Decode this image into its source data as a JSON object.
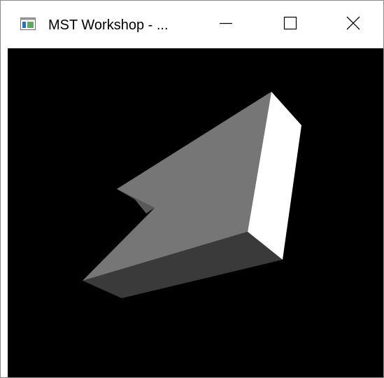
{
  "window": {
    "title": "MST Workshop - ...",
    "icons": {
      "app": "app-window-icon",
      "minimize": "minimize-icon",
      "maximize": "maximize-icon",
      "close": "close-icon"
    }
  },
  "viewport": {
    "background": "#000000",
    "content": "3d-rendered-prism",
    "face_colors": [
      "#767676",
      "#ffffff",
      "#3a3a3a",
      "#5a5a5a"
    ]
  }
}
